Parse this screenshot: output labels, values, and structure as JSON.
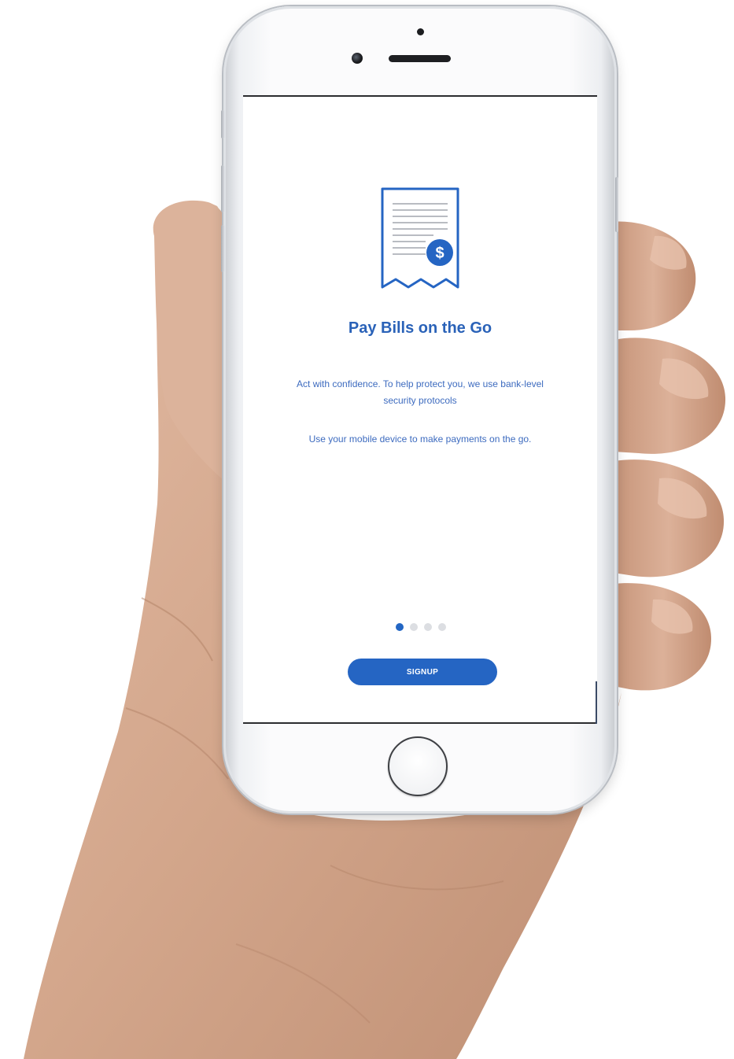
{
  "screen": {
    "title": "Pay Bills on the Go",
    "body_line_1": "Act with confidence. To help protect you, we use bank-level security protocols",
    "body_line_2": "Use your mobile device to make payments on the go.",
    "pager": {
      "total": 4,
      "active_index": 0
    },
    "signup_label": "SIGNUP",
    "icon": "receipt-dollar-icon"
  },
  "colors": {
    "accent": "#2565c3",
    "title_text": "#2a62b8",
    "body_text": "#3d6bbf",
    "pager_inactive": "#dcdee2",
    "skin": "#d4a98e"
  }
}
